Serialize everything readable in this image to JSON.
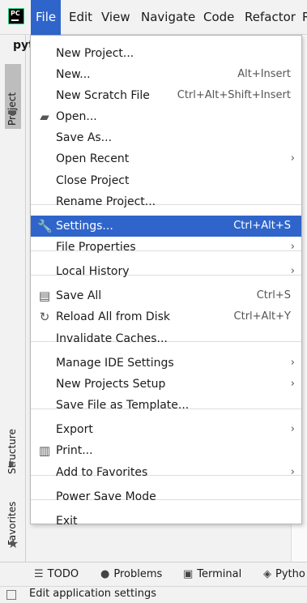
{
  "menubar": {
    "items": [
      "File",
      "Edit",
      "View",
      "Navigate",
      "Code",
      "Refactor",
      "R"
    ]
  },
  "crumb": "pyt",
  "sidebar": {
    "project": "Project",
    "structure": "Structure",
    "favorites": "Favorites"
  },
  "file_menu": {
    "items": [
      {
        "label": "New Project...",
        "shortcut": "",
        "submenu": false,
        "icon": ""
      },
      {
        "label": "New...",
        "shortcut": "Alt+Insert",
        "submenu": false,
        "icon": ""
      },
      {
        "label": "New Scratch File",
        "shortcut": "Ctrl+Alt+Shift+Insert",
        "submenu": false,
        "icon": ""
      },
      {
        "label": "Open...",
        "shortcut": "",
        "submenu": false,
        "icon": "folder-icon"
      },
      {
        "label": "Save As...",
        "shortcut": "",
        "submenu": false,
        "icon": ""
      },
      {
        "label": "Open Recent",
        "shortcut": "",
        "submenu": true,
        "icon": ""
      },
      {
        "label": "Close Project",
        "shortcut": "",
        "submenu": false,
        "icon": ""
      },
      {
        "label": "Rename Project...",
        "shortcut": "",
        "submenu": false,
        "icon": ""
      },
      {
        "label": "Settings...",
        "shortcut": "Ctrl+Alt+S",
        "submenu": false,
        "icon": "wrench-icon",
        "highlighted": true
      },
      {
        "label": "File Properties",
        "shortcut": "",
        "submenu": true,
        "icon": ""
      },
      {
        "label": "Local History",
        "shortcut": "",
        "submenu": true,
        "icon": ""
      },
      {
        "label": "Save All",
        "shortcut": "Ctrl+S",
        "submenu": false,
        "icon": "save-icon"
      },
      {
        "label": "Reload All from Disk",
        "shortcut": "Ctrl+Alt+Y",
        "submenu": false,
        "icon": "reload-icon"
      },
      {
        "label": "Invalidate Caches...",
        "shortcut": "",
        "submenu": false,
        "icon": ""
      },
      {
        "label": "Manage IDE Settings",
        "shortcut": "",
        "submenu": true,
        "icon": ""
      },
      {
        "label": "New Projects Setup",
        "shortcut": "",
        "submenu": true,
        "icon": ""
      },
      {
        "label": "Save File as Template...",
        "shortcut": "",
        "submenu": false,
        "icon": ""
      },
      {
        "label": "Export",
        "shortcut": "",
        "submenu": true,
        "icon": ""
      },
      {
        "label": "Print...",
        "shortcut": "",
        "submenu": false,
        "icon": "print-icon"
      },
      {
        "label": "Add to Favorites",
        "shortcut": "",
        "submenu": true,
        "icon": ""
      },
      {
        "label": "Power Save Mode",
        "shortcut": "",
        "submenu": false,
        "icon": ""
      },
      {
        "label": "Exit",
        "shortcut": "",
        "submenu": false,
        "icon": ""
      }
    ]
  },
  "toolwindows": [
    "TODO",
    "Problems",
    "Terminal",
    "Pytho"
  ],
  "status": "Edit application settings",
  "colors": {
    "highlight": "#2f65ca",
    "logo_border": "#21d789"
  }
}
